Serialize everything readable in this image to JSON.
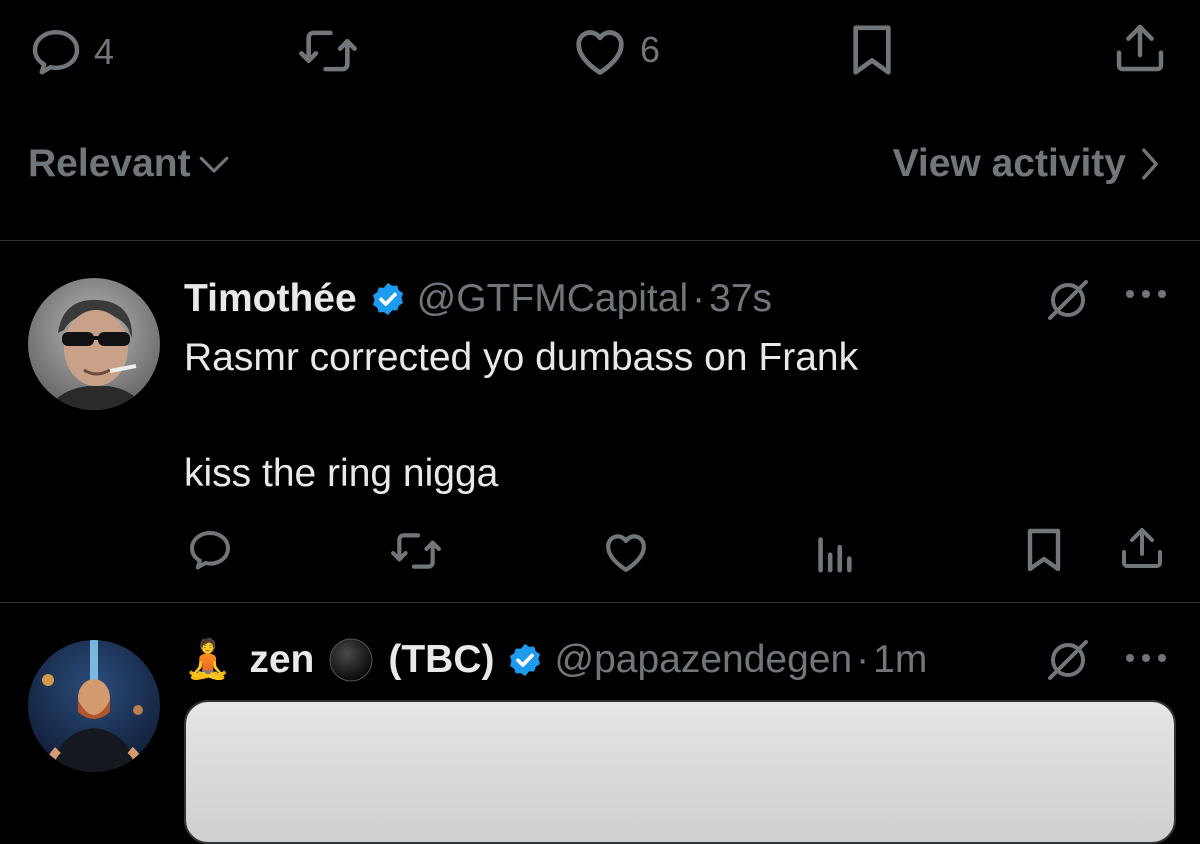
{
  "top_actions": {
    "reply_count": "4",
    "like_count": "6"
  },
  "sort": {
    "relevant_label": "Relevant",
    "view_activity_label": "View activity"
  },
  "posts": [
    {
      "name": "Timothée",
      "handle": "@GTFMCapital",
      "separator": "·",
      "time": "37s",
      "line1": "Rasmr corrected yo dumbass on Frank",
      "line2": "kiss the ring nigga"
    },
    {
      "emoji": "🧘",
      "name": "zen",
      "name_suffix": "(TBC)",
      "handle": "@papazendegen",
      "separator": "·",
      "time": "1m"
    }
  ],
  "colors": {
    "background": "#000000",
    "text": "#e7e9ea",
    "muted": "#71767b",
    "verified": "#1d9bf0",
    "divider": "#2f3336"
  },
  "icons": [
    "reply-icon",
    "repost-icon",
    "like-icon",
    "bookmark-icon",
    "share-icon",
    "grok-icon",
    "more-icon",
    "views-icon",
    "verified-badge-icon",
    "chevron-down-icon",
    "chevron-right-icon"
  ]
}
